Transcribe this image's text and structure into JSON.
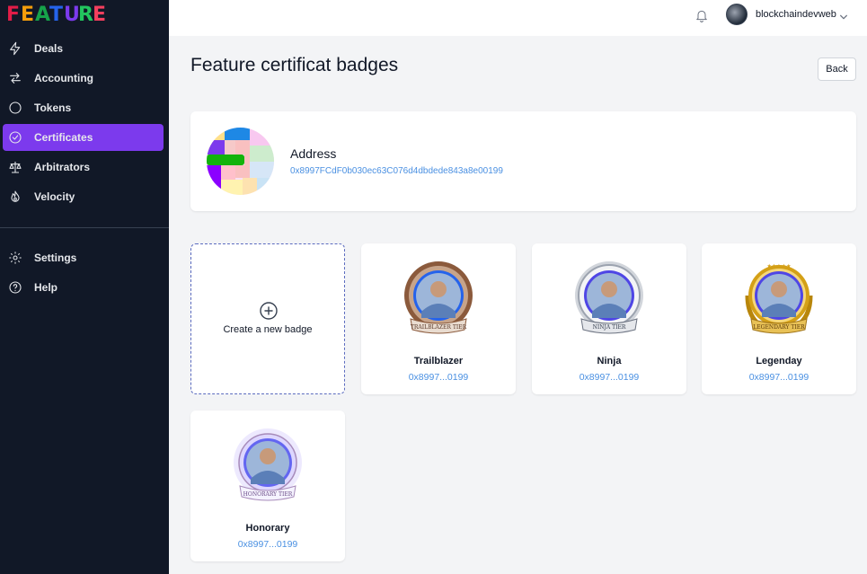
{
  "app": {
    "logo_text": "FEATURE",
    "logo_letters": [
      "F",
      "E",
      "A",
      "T",
      "U",
      "R",
      "E"
    ],
    "logo_colors": [
      "#e11d48",
      "#f59e0b",
      "#16a34a",
      "#2563eb",
      "#7c3aed",
      "#22c55e",
      "#f43f5e"
    ]
  },
  "sidebar": {
    "items": [
      {
        "label": "Deals",
        "icon": "bolt-icon",
        "active": false
      },
      {
        "label": "Accounting",
        "icon": "arrows-exchange-icon",
        "active": false
      },
      {
        "label": "Tokens",
        "icon": "circle-icon",
        "active": false
      },
      {
        "label": "Certificates",
        "icon": "check-circle-icon",
        "active": true
      },
      {
        "label": "Arbitrators",
        "icon": "scale-icon",
        "active": false
      },
      {
        "label": "Velocity",
        "icon": "fire-icon",
        "active": false
      }
    ],
    "bottom_items": [
      {
        "label": "Settings",
        "icon": "gear-icon"
      },
      {
        "label": "Help",
        "icon": "question-circle-icon"
      }
    ],
    "active_color": "#7c3aed"
  },
  "topbar": {
    "username": "blockchaindevweb",
    "bell_icon": "bell-icon",
    "dropdown_icon": "chevron-down-icon"
  },
  "page": {
    "title": "Feature certificat badges",
    "back_label": "Back"
  },
  "address_card": {
    "label": "Address",
    "value": "0x8997FCdF0b030ec63C076d4dbdede843a8e00199"
  },
  "new_badge": {
    "label": "Create a new badge",
    "icon": "plus-circle-icon"
  },
  "badges": [
    {
      "name": "Trailblazer",
      "address": "0x8997...0199",
      "ribbon": "TRAILBLAZER TIER",
      "tier_color": "#8b5a3c",
      "ring_color": "#b5651d"
    },
    {
      "name": "Ninja",
      "address": "0x8997...0199",
      "ribbon": "NINJA TIER",
      "tier_color": "#9ca3af",
      "ring_color": "#6b7280"
    },
    {
      "name": "Legenday",
      "address": "0x8997...0199",
      "ribbon": "LEGENDARY TIER",
      "tier_color": "#d4a017",
      "ring_color": "#b8860b"
    },
    {
      "name": "Honorary",
      "address": "0x8997...0199",
      "ribbon": "HONORARY TIER",
      "tier_color": "#a78bba",
      "ring_color": "#c4b5fd"
    }
  ]
}
